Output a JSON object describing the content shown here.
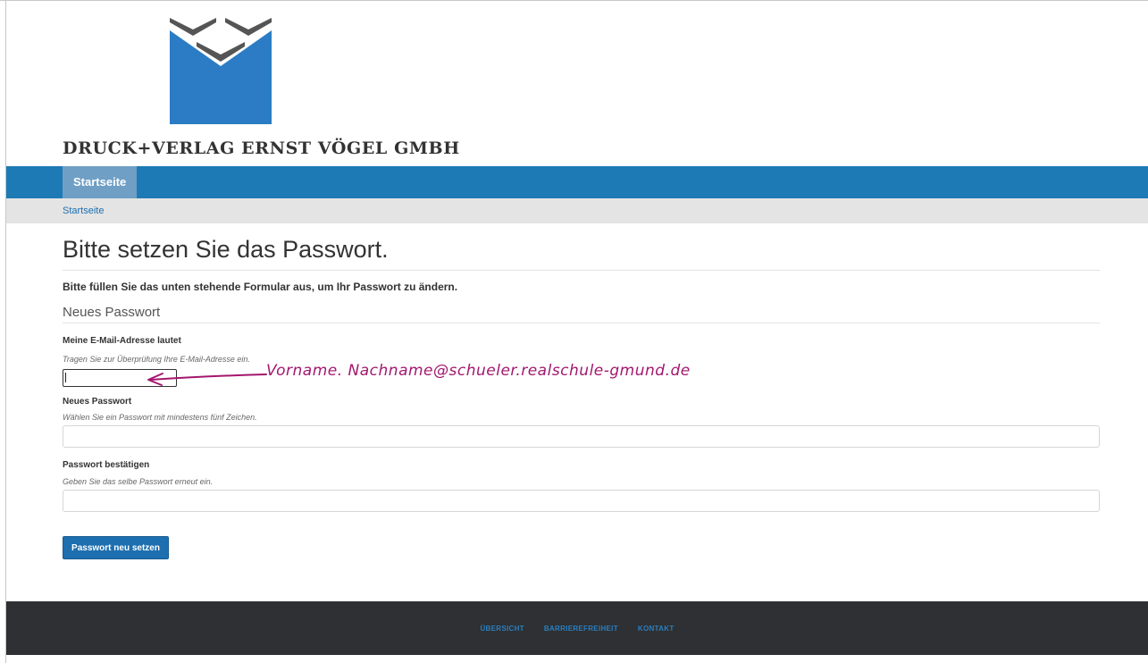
{
  "header": {
    "company_name": "DRUCK+VERLAG ERNST VÖGEL GMBH",
    "logo_icon": "company-logo-icon",
    "brand_colors": {
      "logo_blue": "#2b7cc4",
      "chevron_gray": "#555555"
    }
  },
  "nav": {
    "items": [
      {
        "label": "Startseite",
        "active": true
      }
    ],
    "background": "#1d7ab5"
  },
  "breadcrumb": {
    "items": [
      "Startseite"
    ]
  },
  "main": {
    "title": "Bitte setzen Sie das Passwort.",
    "intro": "Bitte füllen Sie das unten stehende Formular aus, um Ihr Passwort zu ändern.",
    "section_title": "Neues Passwort",
    "fields": [
      {
        "label": "Meine E-Mail-Adresse lautet",
        "help": "Tragen Sie zur Überprüfung Ihre E-Mail-Adresse ein.",
        "value": ""
      },
      {
        "label": "Neues Passwort",
        "help": "Wählen Sie ein Passwort mit mindestens fünf Zeichen.",
        "value": ""
      },
      {
        "label": "Passwort bestätigen",
        "help": "Geben Sie das selbe Passwort erneut ein.",
        "value": ""
      }
    ],
    "submit_label": "Passwort neu setzen"
  },
  "annotation": {
    "text": "Vorname. Nachname@schueler.realschule-gmund.de",
    "color": "#a3176e"
  },
  "footer": {
    "links": [
      "ÜBERSICHT",
      "BARRIEREFREIHEIT",
      "KONTAKT"
    ]
  }
}
